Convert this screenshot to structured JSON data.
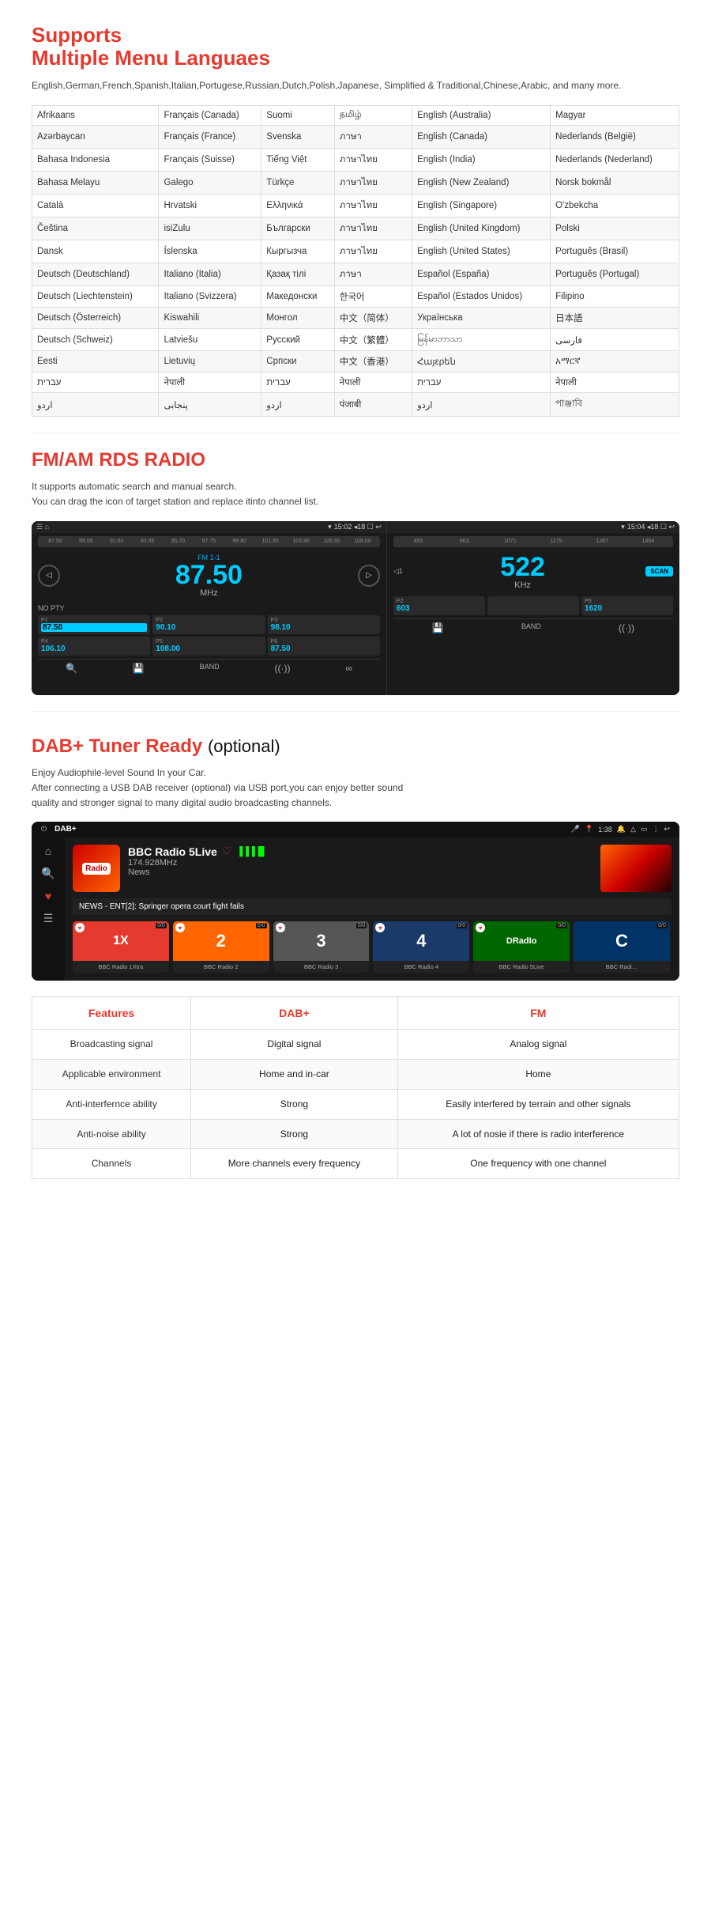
{
  "languages": {
    "section_title_line1": "Supports",
    "section_title_line2": "Multiple Menu Languaes",
    "subtitle": "English,German,French,Spanish,Italian,Portugese,Russian,Dutch,Polish,Japanese,\nSimplified & Traditional,Chinese,Arabic, and many more.",
    "columns": [
      [
        "Afrikaans",
        "Azərbaycan",
        "Bahasa Indonesia",
        "Bahasa Melayu",
        "Català",
        "Čeština",
        "Dansk",
        "Deutsch (Deutschland)",
        "Deutsch (Liechtenstein)",
        "Deutsch (Österreich)",
        "Deutsch (Schweiz)",
        "Eesti",
        "עברית",
        "اردو"
      ],
      [
        "Français (Canada)",
        "Français (France)",
        "Français (Suisse)",
        "Galego",
        "Hrvatski",
        "isiZulu",
        "Íslenska",
        "Italiano (Italia)",
        "Italiano (Svizzera)",
        "Kiswahili",
        "Latviešu",
        "Lietuvių",
        "नेपाली",
        "پنجابی"
      ],
      [
        "Suomi",
        "Svenska",
        "Tiếng Việt",
        "Türkçe",
        "Ελληνικά",
        "Български",
        "Кыргызча",
        "Қазақ тілі",
        "Македонски",
        "Монгол",
        "Русский",
        "Српски",
        "עברית",
        "اردو"
      ],
      [
        "தமிழ்",
        "ภาษา",
        "ภาษาไทย",
        "ภาษาไทย",
        "ภาษาไทย",
        "ภาษาไทย",
        "ภาษาไทย",
        "ภาษา",
        "한국어",
        "中文（简体）",
        "中文（繁體）",
        "中文（香港）",
        "नेपाली",
        "पंजाबी"
      ],
      [
        "English (Australia)",
        "English (Canada)",
        "English (India)",
        "English (New Zealand)",
        "English (Singapore)",
        "English (United Kingdom)",
        "English (United States)",
        "Español (España)",
        "Español (Estados Unidos)",
        "Українська",
        "မြန်မာဘာသာ",
        "Հայερեն",
        "עברית",
        "اردو"
      ],
      [
        "Magyar",
        "Nederlands (België)",
        "Nederlands (Nederland)",
        "Norsk bokmål",
        "O'zbekcha",
        "Polski",
        "Português (Brasil)",
        "Português (Portugal)",
        "Filipino",
        "日本語",
        "فارسی",
        "አማርኛ",
        "नेपाली",
        "পাঞ্জাবি"
      ]
    ]
  },
  "radio": {
    "section_title_regular": "FM/AM",
    "section_title_bold": "RDS RADIO",
    "subtitle_line1": "It supports automatic search and manual search.",
    "subtitle_line2": "You can drag the icon of target station and replace itinto channel list.",
    "screen1": {
      "statusbar": "15:02  ◂18  ☐  ↩",
      "freq_markers": [
        "87.50",
        "89.55",
        "91.60",
        "93.65",
        "95.70",
        "97.75",
        "99.80",
        "101.85",
        "103.90",
        "105.95",
        "108.00"
      ],
      "channel_label": "FM 1-1",
      "frequency": "87.50",
      "unit": "MHz",
      "pty": "NO PTY",
      "presets": [
        {
          "label": "P1",
          "freq": "87.50",
          "active": true
        },
        {
          "label": "P2",
          "freq": "90.10"
        },
        {
          "label": "P3",
          "freq": "98.10"
        },
        {
          "label": "P4",
          "freq": "106.10"
        },
        {
          "label": "P5",
          "freq": "108.00"
        },
        {
          "label": "P6",
          "freq": "87.50"
        }
      ]
    },
    "screen2": {
      "statusbar": "15:04  ◂18  ☐  ↩",
      "freq_markers": [
        "855",
        "963",
        "1071",
        "1179",
        "1287",
        "1404"
      ],
      "frequency": "522",
      "unit": "KHz",
      "scan_btn": "SCAN",
      "presets": [
        {
          "label": "P2",
          "freq": "603"
        },
        {
          "label": "P5",
          "freq": "1620"
        }
      ]
    }
  },
  "dab": {
    "section_title": "DAB+ Tuner Ready",
    "section_title_optional": "(optional)",
    "subtitle_line1": "Enjoy Audiophile-level Sound In your Car.",
    "subtitle_line2": "After connecting a USB DAB receiver (optional) via USB port,you can enjoy better sound",
    "subtitle_line3": "quality and stronger signal to many digital audio broadcasting channels.",
    "screenshot": {
      "statusbar_left": "DAB+",
      "statusbar_time": "1:38",
      "station_name": "BBC Radio 5Live",
      "frequency": "174.928MHz",
      "genre": "News",
      "news_ticker": "NEWS - ENT[2]: Springer opera court fight fails",
      "channels": [
        {
          "name": "BBC Radio 1Xtra",
          "short": "1X",
          "num": "0/0"
        },
        {
          "name": "BBC Radio 2",
          "short": "2",
          "num": "0/0"
        },
        {
          "name": "BBC Radio 3",
          "short": "3",
          "num": "0/0"
        },
        {
          "name": "BBC Radio 4",
          "short": "4",
          "num": "0/0"
        },
        {
          "name": "BBC Radio 5Live",
          "short": "DR",
          "num": "0/0"
        },
        {
          "name": "BBC Radi…",
          "short": "C",
          "num": "0/0"
        }
      ]
    }
  },
  "comparison": {
    "headers": [
      "Features",
      "DAB+",
      "FM"
    ],
    "rows": [
      {
        "feature": "Broadcasting signal",
        "dab": "Digital signal",
        "fm": "Analog signal"
      },
      {
        "feature": "Applicable environment",
        "dab": "Home and in-car",
        "fm": "Home"
      },
      {
        "feature": "Anti-interfernce ability",
        "dab": "Strong",
        "fm": "Easily interfered by terrain and other signals"
      },
      {
        "feature": "Anti-noise ability",
        "dab": "Strong",
        "fm": "A lot of nosie if there is radio interference"
      },
      {
        "feature": "Channels",
        "dab": "More channels every frequency",
        "fm": "One frequency with one channel"
      }
    ]
  }
}
